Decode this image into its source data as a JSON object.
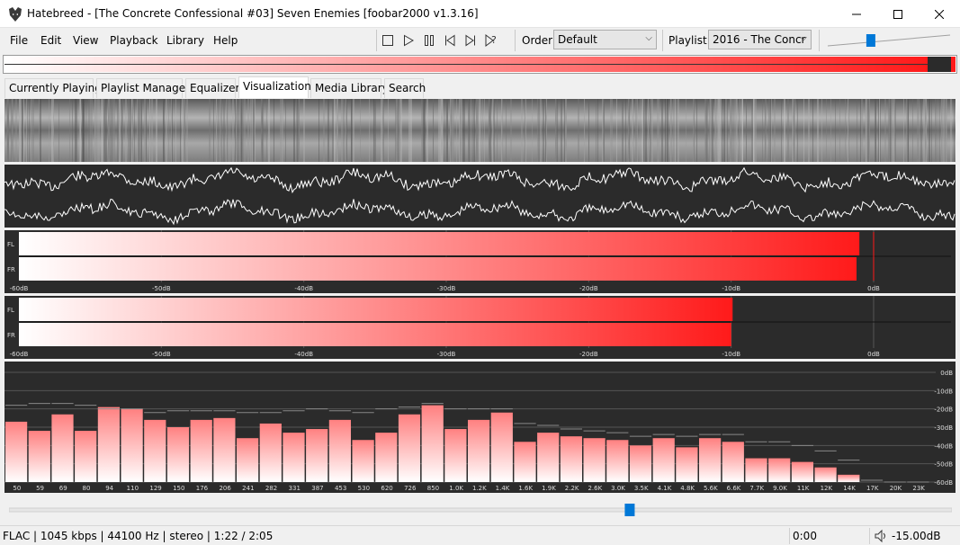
{
  "window": {
    "title": "Hatebreed - [The Concrete Confessional #03] Seven Enemies   [foobar2000 v1.3.16]",
    "minimize_icon": "minimize-icon",
    "maximize_icon": "maximize-icon",
    "close_icon": "close-icon"
  },
  "menu": {
    "items": [
      "File",
      "Edit",
      "View",
      "Playback",
      "Library",
      "Help"
    ]
  },
  "toolbar": {
    "buttons": [
      "stop-icon",
      "play-icon",
      "pause-icon",
      "previous-icon",
      "next-icon",
      "random-icon"
    ],
    "order_label": "Order:",
    "order_value": "Default",
    "playlist_label": "Playlist:",
    "playlist_value": "2016 - The Concr",
    "volume_level": 0.33
  },
  "tabs": [
    "Currently Playing",
    "Playlist Manager",
    "Equalizer",
    "Visualization",
    "Media Library",
    "Search"
  ],
  "active_tab": "Visualization",
  "colors": {
    "accent": "#ff1a1a",
    "panel_bg": "#2b2b2b",
    "slider_thumb": "#0078d7"
  },
  "vu_meters": {
    "channels": [
      "FL",
      "FR"
    ],
    "scale": [
      "-60dB",
      "-50dB",
      "-40dB",
      "-30dB",
      "-20dB",
      "-10dB",
      "0dB"
    ],
    "peak_levels_db": [
      -1.0,
      -1.2
    ],
    "rms_levels_db": [
      -9.9,
      -10.0
    ]
  },
  "spectrum": {
    "db_labels": [
      "0dB",
      "-10dB",
      "-20dB",
      "-30dB",
      "-40dB",
      "-50dB",
      "-60dB"
    ],
    "freq_labels": [
      "50",
      "59",
      "69",
      "80",
      "94",
      "110",
      "129",
      "150",
      "176",
      "206",
      "241",
      "282",
      "331",
      "387",
      "453",
      "530",
      "620",
      "726",
      "850",
      "1.0K",
      "1.2K",
      "1.4K",
      "1.6K",
      "1.9K",
      "2.2K",
      "2.6K",
      "3.0K",
      "3.5K",
      "4.1K",
      "4.8K",
      "5.6K",
      "6.6K",
      "7.7K",
      "9.0K",
      "11K",
      "12K",
      "14K",
      "17K",
      "20K",
      "23K"
    ],
    "bar_levels_db": [
      -27,
      -32,
      -23,
      -32,
      -19,
      -20,
      -26,
      -30,
      -26,
      -25,
      -36,
      -28,
      -33,
      -31,
      -26,
      -37,
      -33,
      -23,
      -18,
      -31,
      -26,
      -22,
      -38,
      -33,
      -35,
      -36,
      -37,
      -40,
      -36,
      -41,
      -36,
      -38,
      -47,
      -47,
      -49,
      -52,
      -56,
      -60,
      -60,
      -60
    ],
    "peak_levels_db": [
      -18,
      -17,
      -17,
      -18,
      -20,
      -20,
      -22,
      -21,
      -21,
      -21,
      -22,
      -22,
      -21,
      -20,
      -21,
      -22,
      -20,
      -19,
      -17,
      -20,
      -20,
      -20,
      -28,
      -29,
      -31,
      -32,
      -33,
      -35,
      -34,
      -35,
      -34,
      -34,
      -38,
      -38,
      -40,
      -43,
      -48,
      -59,
      -60,
      -60
    ]
  },
  "seek": {
    "position_fraction": 0.66
  },
  "status": {
    "info": "FLAC | 1045 kbps | 44100 Hz | stereo | 1:22 / 2:05",
    "time": "0:00",
    "volume": "-15.00dB",
    "volume_icon": "speaker-icon"
  }
}
